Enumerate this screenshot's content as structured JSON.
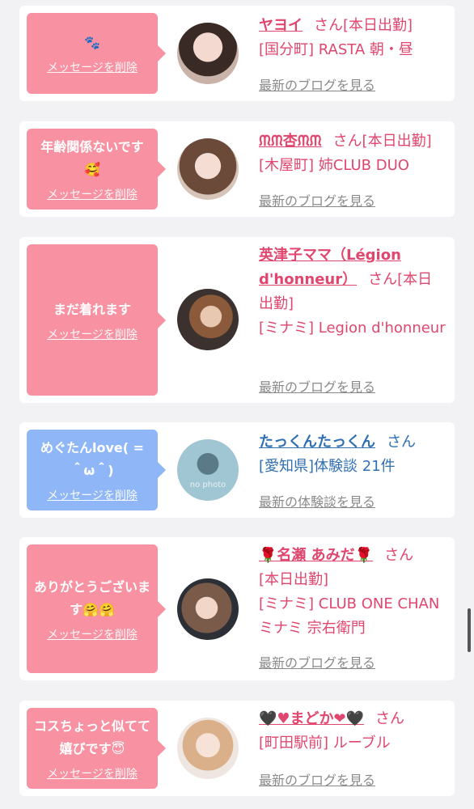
{
  "cards": [
    {
      "message": "🐾",
      "delete_label": "メッセージを削除",
      "name": "ヤヨイ",
      "san": "さん",
      "status": "[本日出勤]",
      "shop": "[国分町] RASTA 朝・昼",
      "link": "最新のブログを見る"
    },
    {
      "message": "年齢関係ないです🥰",
      "delete_label": "メッセージを削除",
      "name": "ᙏᙏ杏ᙏᙏ",
      "san": "さん",
      "status": "[本日出勤]",
      "shop": "[木屋町] 姉CLUB DUO",
      "link": "最新のブログを見る"
    },
    {
      "message": "まだ着れます",
      "delete_label": "メッセージを削除",
      "name": "英津子ママ（Légion d'honneur）",
      "san": "さん",
      "status": "[本日出勤]",
      "shop": "[ミナミ] Legion d'honneur",
      "link": "最新のブログを見る"
    },
    {
      "message": "めぐたんlove( = ＾ω＾)",
      "delete_label": "メッセージを削除",
      "name": "たっくんたっくん",
      "san": "さん",
      "shop": "[愛知県]体験談 21件",
      "link": "最新の体験談を見る",
      "avatar_text": "no photo"
    },
    {
      "message": "ありがとうございます🤗🤗",
      "delete_label": "メッセージを削除",
      "name": "🌹名瀬 あみだ🌹",
      "san": "さん",
      "status": "[本日出勤]",
      "shop": "[ミナミ] CLUB ONE CHAN ミナミ 宗右衛門",
      "link": "最新のブログを見る"
    },
    {
      "message": "コスちょっと似てて嬉びです😇",
      "delete_label": "メッセージを削除",
      "name": "🖤♥まどか❤🖤",
      "san": "さん",
      "shop": "[町田駅前] ルーブル",
      "link": "最新のブログを見る"
    }
  ],
  "colors": {
    "pink_bubble": "#f891a1",
    "blue_bubble": "#8fb7f7",
    "shop_text": "#e0466e",
    "user_text": "#2f6fb3",
    "link_text": "#8a8a8a"
  }
}
